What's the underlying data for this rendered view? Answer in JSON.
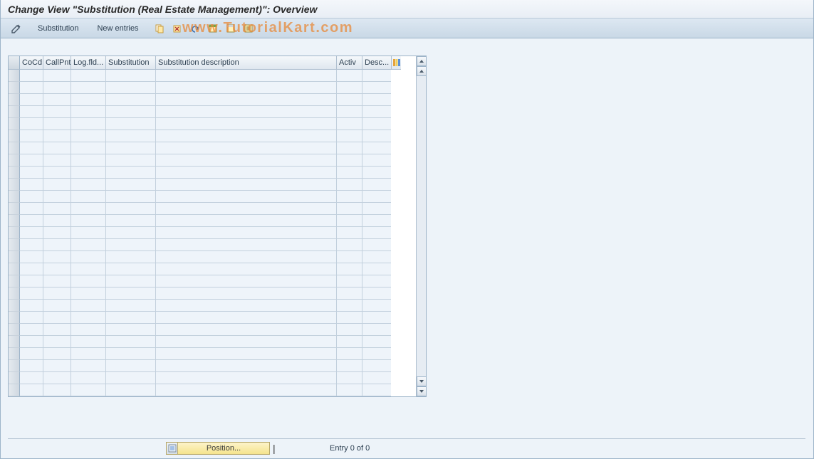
{
  "title": "Change View \"Substitution (Real Estate Management)\": Overview",
  "toolbar": {
    "substitution_label": "Substitution",
    "new_entries_label": "New entries"
  },
  "watermark_text": "www.TutorialKart.com",
  "columns": {
    "cocd": "CoCd",
    "callpnt": "CallPnt",
    "logfld": "Log.fld...",
    "substitution": "Substitution",
    "subst_desc": "Substitution description",
    "activ": "Activ",
    "descr2": "Desc..."
  },
  "footer": {
    "position_label": "Position...",
    "entry_text": "Entry 0 of 0"
  },
  "row_count": 27
}
